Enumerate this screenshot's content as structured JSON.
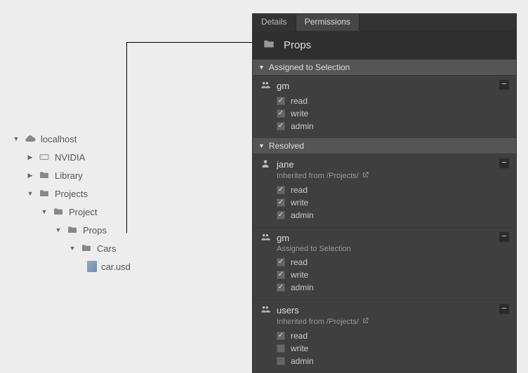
{
  "tree": {
    "root": "localhost",
    "items": [
      "NVIDIA",
      "Library",
      "Projects",
      "Project",
      "Props",
      "Cars",
      "car.usd"
    ]
  },
  "tabs": {
    "details": "Details",
    "permissions": "Permissions"
  },
  "folder_title": "Props",
  "sections": {
    "assigned": "Assigned to Selection",
    "resolved": "Resolved"
  },
  "perm_labels": {
    "read": "read",
    "write": "write",
    "admin": "admin"
  },
  "assigned": [
    {
      "name": "gm",
      "kind": "group",
      "sub": null,
      "read": true,
      "write": true,
      "admin": true
    }
  ],
  "resolved": [
    {
      "name": "jane",
      "kind": "user",
      "sub": "Inherited from /Projects/",
      "link": true,
      "read": true,
      "write": true,
      "admin": true
    },
    {
      "name": "gm",
      "kind": "group",
      "sub": "Assigned to Selection",
      "link": false,
      "read": true,
      "write": true,
      "admin": true
    },
    {
      "name": "users",
      "kind": "group",
      "sub": "Inherited from /Projects/",
      "link": true,
      "read": true,
      "write": false,
      "admin": false
    }
  ]
}
